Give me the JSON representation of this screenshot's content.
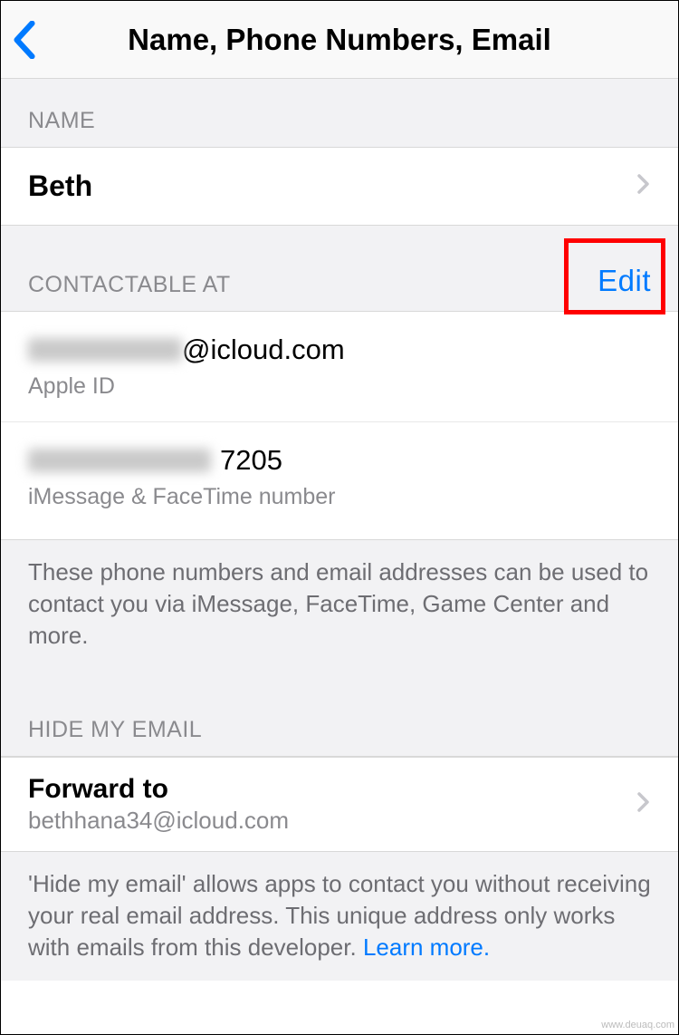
{
  "header": {
    "title": "Name, Phone Numbers, Email"
  },
  "sections": {
    "name": {
      "header": "NAME",
      "value": "Beth"
    },
    "contactable": {
      "header": "CONTACTABLE AT",
      "edit_label": "Edit",
      "items": [
        {
          "value_suffix": "@icloud.com",
          "subtitle": "Apple ID"
        },
        {
          "value_suffix": "7205",
          "subtitle": "iMessage & FaceTime number"
        }
      ],
      "footer": "These phone numbers and email addresses can be used to contact you via iMessage, FaceTime, Game Center and more."
    },
    "hide_email": {
      "header": "HIDE MY EMAIL",
      "forward_label": "Forward to",
      "forward_email": "bethhana34@icloud.com",
      "footer_part1": "'Hide my email' allows apps to contact you without receiving your real email address. This unique address only works with emails from this developer. ",
      "learn_more": "Learn more."
    }
  },
  "watermark": "www.deuaq.com"
}
